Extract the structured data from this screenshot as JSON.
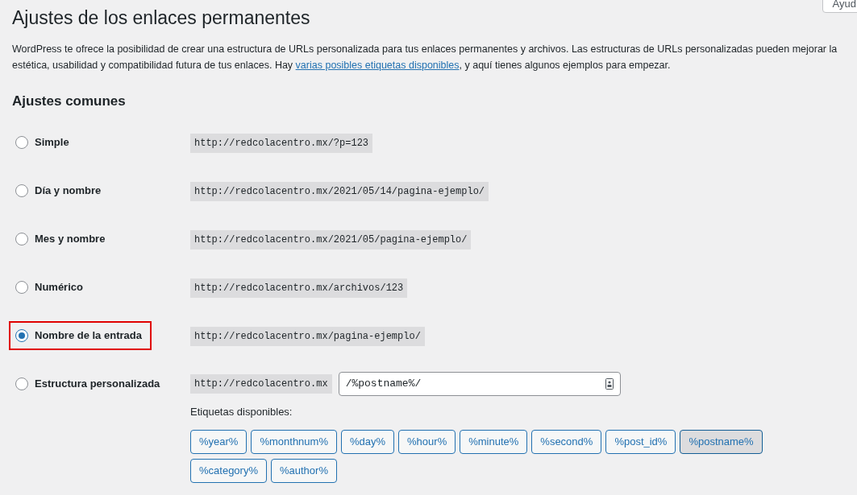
{
  "help_button": "Ayud",
  "title": "Ajustes de los enlaces permanentes",
  "intro": {
    "before": "WordPress te ofrece la posibilidad de crear una estructura de URLs personalizada para tus enlaces permanentes y archivos. Las estructuras de URLs personalizadas pueden mejorar la estética, usabilidad y compatibilidad futura de tus enlaces. Hay",
    "link": "varias posibles etiquetas disponibles",
    "after": ", y aquí tienes algunos ejemplos para empezar."
  },
  "section_title": "Ajustes comunes",
  "options": [
    {
      "kind": "preset",
      "label": "Simple",
      "example": "http://redcolacentro.mx/?p=123",
      "selected": false,
      "highlighted": false
    },
    {
      "kind": "preset",
      "label": "Día y nombre",
      "example": "http://redcolacentro.mx/2021/05/14/pagina-ejemplo/",
      "selected": false,
      "highlighted": false
    },
    {
      "kind": "preset",
      "label": "Mes y nombre",
      "example": "http://redcolacentro.mx/2021/05/pagina-ejemplo/",
      "selected": false,
      "highlighted": false
    },
    {
      "kind": "preset",
      "label": "Numérico",
      "example": "http://redcolacentro.mx/archivos/123",
      "selected": false,
      "highlighted": false
    },
    {
      "kind": "preset",
      "label": "Nombre de la entrada",
      "example": "http://redcolacentro.mx/pagina-ejemplo/",
      "selected": true,
      "highlighted": true
    },
    {
      "kind": "custom",
      "label": "Estructura personalizada",
      "example": "http://redcolacentro.mx",
      "value": "/%postname%/",
      "selected": false,
      "highlighted": false
    }
  ],
  "tags_label": "Etiquetas disponibles:",
  "tags": [
    {
      "label": "%year%",
      "selected": false
    },
    {
      "label": "%monthnum%",
      "selected": false
    },
    {
      "label": "%day%",
      "selected": false
    },
    {
      "label": "%hour%",
      "selected": false
    },
    {
      "label": "%minute%",
      "selected": false
    },
    {
      "label": "%second%",
      "selected": false
    },
    {
      "label": "%post_id%",
      "selected": false
    },
    {
      "label": "%postname%",
      "selected": true
    },
    {
      "label": "%category%",
      "selected": false
    },
    {
      "label": "%author%",
      "selected": false
    }
  ]
}
